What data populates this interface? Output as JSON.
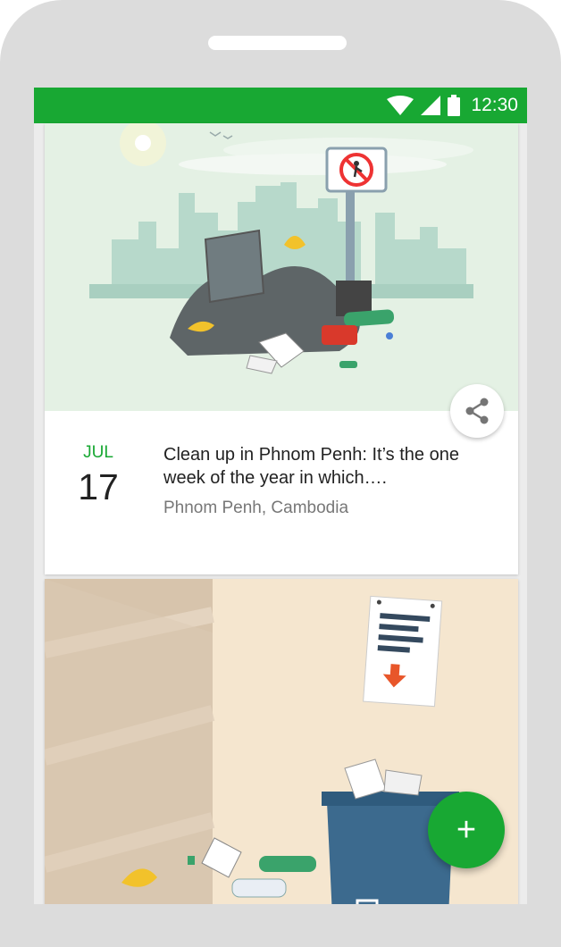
{
  "status_bar": {
    "time": "12:30",
    "icons": [
      "wifi-icon",
      "cellular-signal-icon",
      "battery-icon"
    ],
    "color": "#18a833"
  },
  "events": [
    {
      "month": "JUL",
      "day": "17",
      "title": "Clean up in Phnom Penh: It’s the one week of the year in which….",
      "location": "Phnom Penh, Cambodia",
      "illustration": "city-garbage-pile-illustration"
    },
    {
      "illustration": "room-overflowing-trash-bin-illustration"
    }
  ],
  "share_icon": "share-icon",
  "fab": {
    "label": "+",
    "icon": "plus-icon",
    "color": "#18a833"
  }
}
